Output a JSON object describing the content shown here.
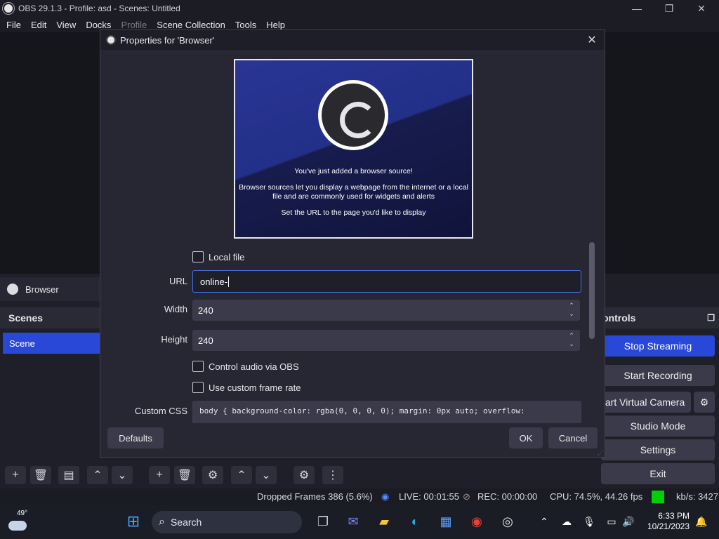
{
  "window": {
    "title": "OBS 29.1.3 - Profile: asd - Scenes: Untitled",
    "minimize_icon": "minimize-icon",
    "maximize_icon": "maximize-icon",
    "close_icon": "close-icon"
  },
  "menu": {
    "items": [
      {
        "label": "File"
      },
      {
        "label": "Edit"
      },
      {
        "label": "View"
      },
      {
        "label": "Docks"
      },
      {
        "label": "Profile",
        "disabled": true
      },
      {
        "label": "Scene Collection"
      },
      {
        "label": "Tools"
      },
      {
        "label": "Help"
      }
    ]
  },
  "sources": {
    "selected": "Browser"
  },
  "scenes": {
    "header": "Scenes",
    "items": [
      "Scene"
    ]
  },
  "controls": {
    "header": "ontrols",
    "buttons": {
      "stop_streaming": "Stop Streaming",
      "start_recording": "Start Recording",
      "start_virtual_camera": "tart Virtual Camera",
      "studio_mode": "Studio Mode",
      "settings": "Settings",
      "exit": "Exit"
    }
  },
  "dialog": {
    "title": "Properties for 'Browser'",
    "preview": {
      "line1": "You've just added a browser source!",
      "line2": "Browser sources let you display a webpage from the internet or a local",
      "line3": "file and are commonly used for widgets and alerts",
      "line4": "Set the URL to the page you'd like to display"
    },
    "fields": {
      "local_file_label": "Local file",
      "url_label": "URL",
      "url_value": "online-",
      "width_label": "Width",
      "width_value": "240",
      "height_label": "Height",
      "height_value": "240",
      "control_audio_label": "Control audio via OBS",
      "custom_frame_rate_label": "Use custom frame rate",
      "custom_css_label": "Custom CSS",
      "custom_css_value": "body { background-color: rgba(0, 0, 0, 0); margin: 0px auto; overflow:"
    },
    "buttons": {
      "defaults": "Defaults",
      "ok": "OK",
      "cancel": "Cancel"
    }
  },
  "status": {
    "dropped_frames": "Dropped Frames 386 (5.6%)",
    "live": "LIVE: 00:01:55",
    "rec": "REC: 00:00:00",
    "cpu": "CPU: 74.5%, 44.26 fps",
    "kbs": "kb/s: 3427",
    "indicator_color": "#00d000"
  },
  "taskbar": {
    "weather_temp": "49°",
    "search_label": "Search",
    "time": "6:33 PM",
    "date": "10/21/2023"
  },
  "colors": {
    "accent": "#2948d8",
    "url_focus": "#4470e6"
  }
}
